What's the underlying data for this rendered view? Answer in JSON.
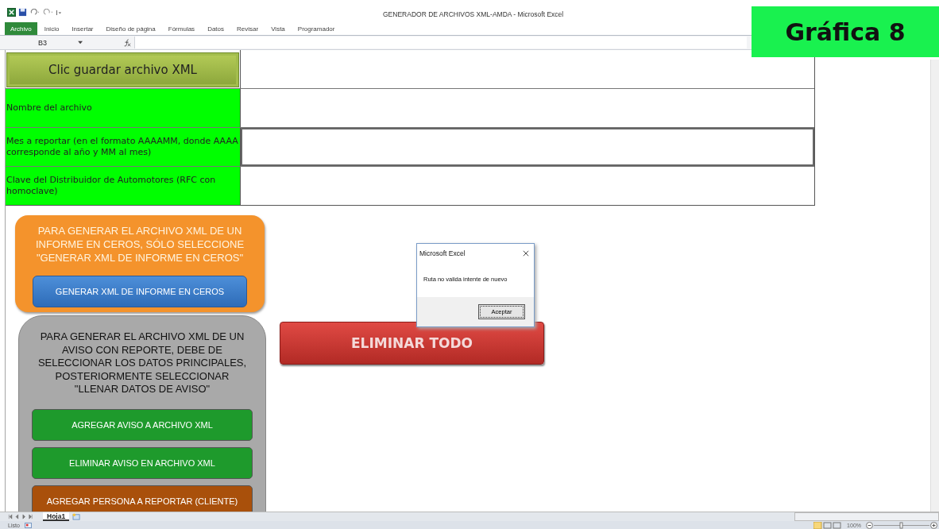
{
  "window": {
    "title": "GENERADOR DE ARCHIVOS XML-AMDA  -  Microsoft Excel"
  },
  "ribbon_tabs": [
    {
      "label": "Archivo",
      "selected": true
    },
    {
      "label": "Inicio",
      "selected": false
    },
    {
      "label": "Insertar",
      "selected": false
    },
    {
      "label": "Diseño de página",
      "selected": false
    },
    {
      "label": "Fórmulas",
      "selected": false
    },
    {
      "label": "Datos",
      "selected": false
    },
    {
      "label": "Revisar",
      "selected": false
    },
    {
      "label": "Vista",
      "selected": false
    },
    {
      "label": "Programador",
      "selected": false
    }
  ],
  "formula_bar": {
    "cell_ref": "B3"
  },
  "caption": "Gráfica 8",
  "form_rows": [
    {
      "kind": "button",
      "label": "Clic guardar archivo XML",
      "selected": false
    },
    {
      "kind": "field",
      "label": "Nombre del archivo",
      "selected": false
    },
    {
      "kind": "field",
      "label": "Mes a reportar (en el formato AAAAMM, donde AAAA corresponde al año y MM al mes)",
      "selected": true
    },
    {
      "kind": "field",
      "label": "Clave del Distribuidor de Automotores (RFC con homoclave)",
      "selected": false
    }
  ],
  "zero_report": {
    "text": "PARA GENERAR EL ARCHIVO XML DE UN INFORME EN CEROS, SÓLO SELECCIONE \"GENERAR XML DE INFORME EN CEROS\"",
    "button": "GENERAR XML  DE INFORME EN CEROS"
  },
  "notice_panel": {
    "text": "PARA GENERAR  EL ARCHIVO XML DE UN AVISO CON REPORTE, DEBE DE SELECCIONAR LOS DATOS PRINCIPALES, POSTERIORMENTE SELECCIONAR \"LLENAR DATOS DE AVISO\"",
    "buttons": [
      {
        "label": "AGREGAR AVISO A ARCHIVO XML",
        "color": "#1e9a2c"
      },
      {
        "label": "ELIMINAR AVISO EN ARCHIVO XML",
        "color": "#1e9a2c"
      },
      {
        "label": "AGREGAR PERSONA A REPORTAR (CLIENTE)",
        "color": "#a9500b"
      }
    ]
  },
  "delete_all_button": "ELIMINAR TODO",
  "dialog": {
    "title": "Microsoft Excel",
    "message": "Ruta no valida intente de nuevo",
    "button": "Aceptar"
  },
  "sheet_tabs": [
    {
      "label": "Hoja1",
      "selected": true
    }
  ],
  "status_bar": {
    "status": "Listo",
    "zoom": "100%"
  }
}
